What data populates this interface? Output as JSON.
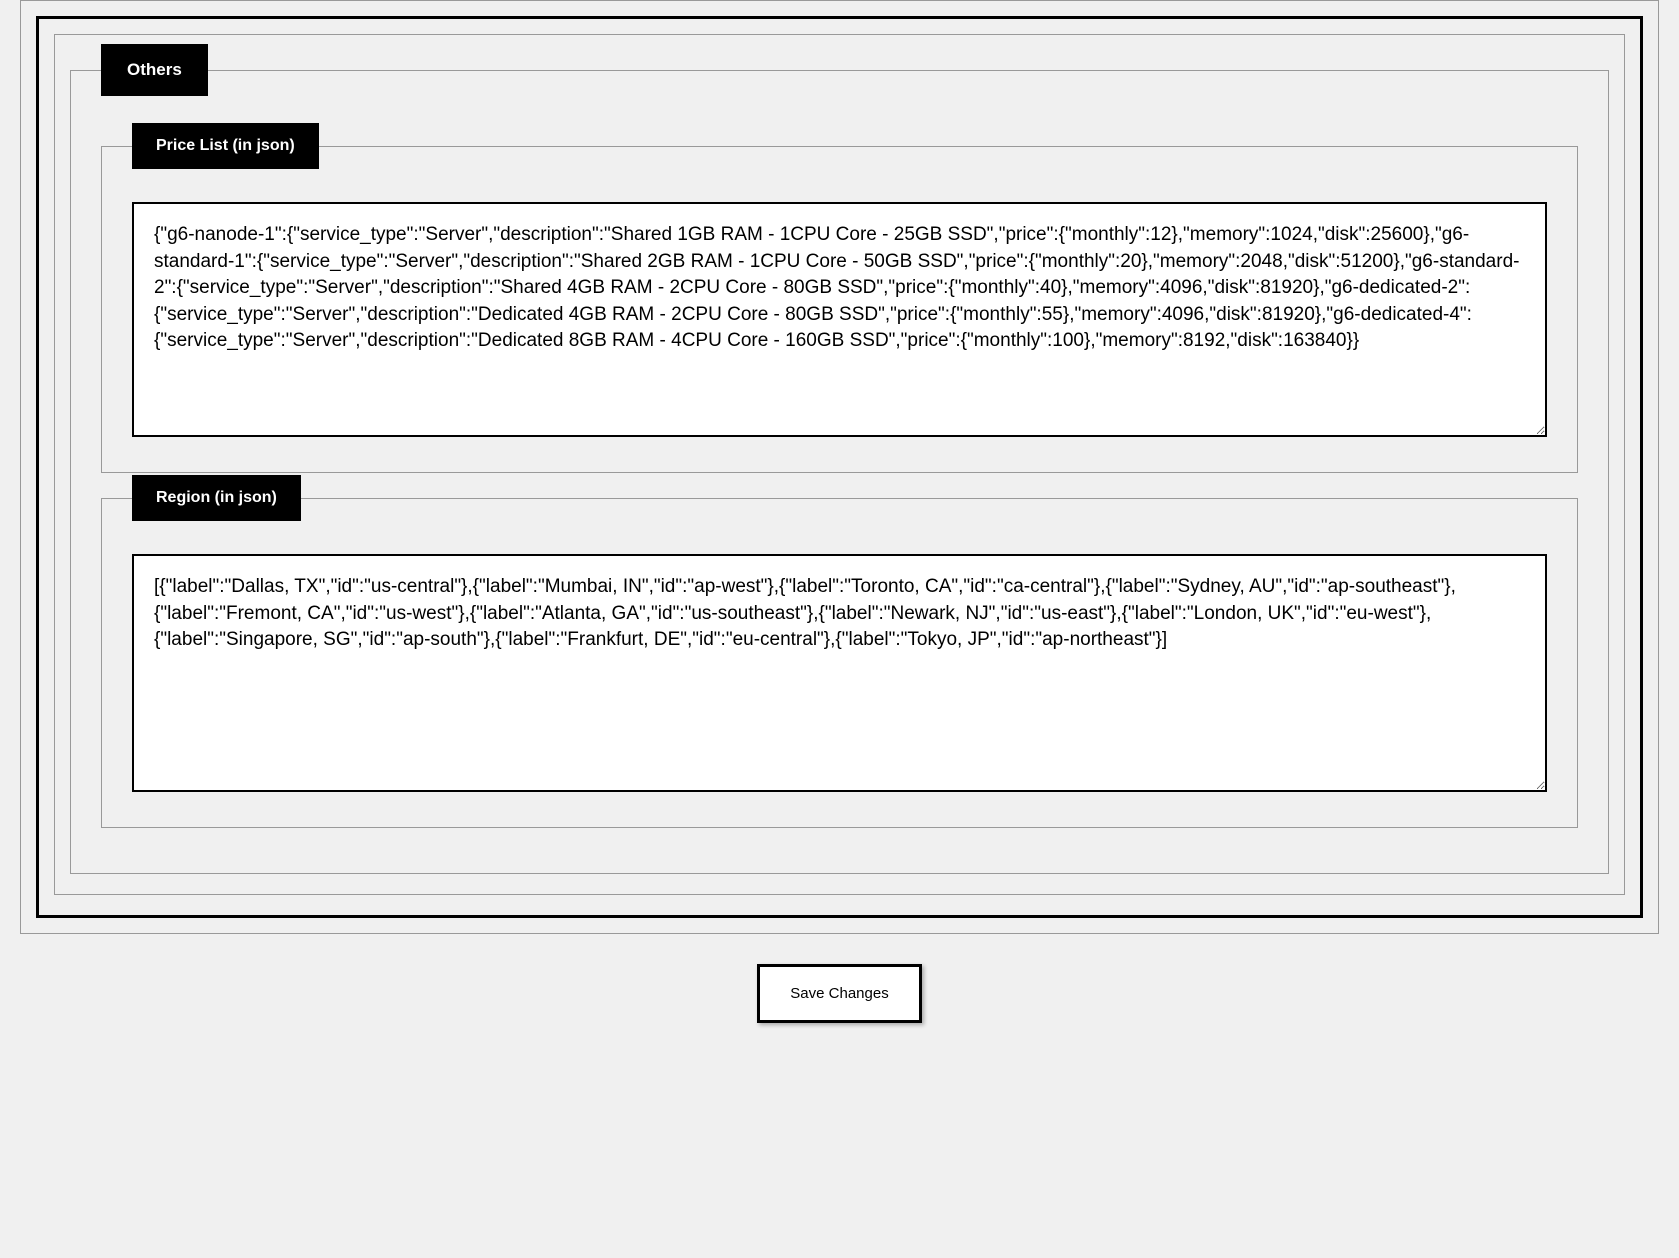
{
  "sections": {
    "others_label": "Others",
    "price_list_label": "Price List (in json)",
    "region_label": "Region (in json)"
  },
  "fields": {
    "price_list_value": "{\"g6-nanode-1\":{\"service_type\":\"Server\",\"description\":\"Shared 1GB RAM - 1CPU Core - 25GB SSD\",\"price\":{\"monthly\":12},\"memory\":1024,\"disk\":25600},\"g6-standard-1\":{\"service_type\":\"Server\",\"description\":\"Shared 2GB RAM - 1CPU Core - 50GB SSD\",\"price\":{\"monthly\":20},\"memory\":2048,\"disk\":51200},\"g6-standard-2\":{\"service_type\":\"Server\",\"description\":\"Shared 4GB RAM - 2CPU Core - 80GB SSD\",\"price\":{\"monthly\":40},\"memory\":4096,\"disk\":81920},\"g6-dedicated-2\":{\"service_type\":\"Server\",\"description\":\"Dedicated 4GB RAM - 2CPU Core - 80GB SSD\",\"price\":{\"monthly\":55},\"memory\":4096,\"disk\":81920},\"g6-dedicated-4\":{\"service_type\":\"Server\",\"description\":\"Dedicated 8GB RAM - 4CPU Core - 160GB SSD\",\"price\":{\"monthly\":100},\"memory\":8192,\"disk\":163840}}",
    "region_value": "[{\"label\":\"Dallas, TX\",\"id\":\"us-central\"},{\"label\":\"Mumbai, IN\",\"id\":\"ap-west\"},{\"label\":\"Toronto, CA\",\"id\":\"ca-central\"},{\"label\":\"Sydney, AU\",\"id\":\"ap-southeast\"},{\"label\":\"Fremont, CA\",\"id\":\"us-west\"},{\"label\":\"Atlanta, GA\",\"id\":\"us-southeast\"},{\"label\":\"Newark, NJ\",\"id\":\"us-east\"},{\"label\":\"London, UK\",\"id\":\"eu-west\"},{\"label\":\"Singapore, SG\",\"id\":\"ap-south\"},{\"label\":\"Frankfurt, DE\",\"id\":\"eu-central\"},{\"label\":\"Tokyo, JP\",\"id\":\"ap-northeast\"}]"
  },
  "buttons": {
    "save_label": "Save Changes"
  }
}
